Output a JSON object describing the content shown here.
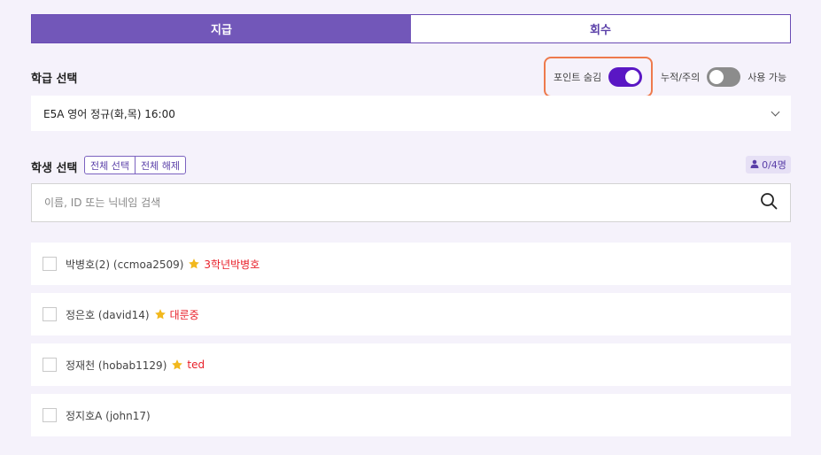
{
  "tabs": [
    {
      "label": "지급",
      "active": true
    },
    {
      "label": "회수",
      "active": false
    }
  ],
  "class_section": {
    "label": "학급 선택",
    "selected": "E5A 영어 정규(화,목) 16:00"
  },
  "toggles": {
    "hide_points": {
      "label": "포인트 숨김",
      "on": true
    },
    "cumulative": {
      "left_label": "누적/주의",
      "right_label": "사용 가능",
      "on": false
    }
  },
  "student_section": {
    "label": "학생 선택",
    "select_all": "전체 선택",
    "deselect_all": "전체 해제",
    "count": "0/4명"
  },
  "search": {
    "placeholder": "이름, ID 또는 닉네임 검색"
  },
  "students": [
    {
      "name": "박병호(2) (ccmoa2509)",
      "has_star": true,
      "nickname": "3학년박병호"
    },
    {
      "name": "정은호 (david14)",
      "has_star": true,
      "nickname": "대룬중"
    },
    {
      "name": "정재천 (hobab1129)",
      "has_star": true,
      "nickname": "ted"
    },
    {
      "name": "정지호A (john17)",
      "has_star": false,
      "nickname": ""
    }
  ],
  "colors": {
    "accent": "#7257b9",
    "toggle_on": "#5a17c4",
    "highlight": "#ee7a4c",
    "nickname": "#e8202a",
    "star": "#f2b81d"
  },
  "icons": [
    "search-icon",
    "chevron-down-icon",
    "person-icon",
    "star-icon"
  ]
}
